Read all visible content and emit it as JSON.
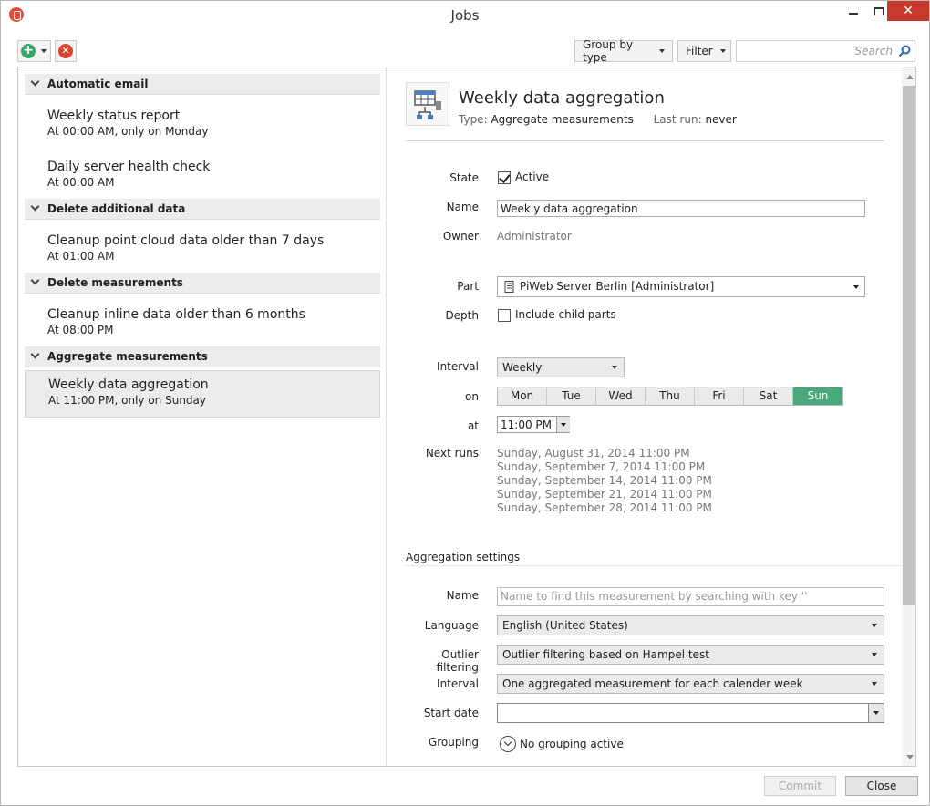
{
  "window": {
    "title": "Jobs"
  },
  "toolbar": {
    "group_by_label": "Group by type",
    "filter_label": "Filter",
    "search_placeholder": "Search"
  },
  "job_groups": [
    {
      "label": "Automatic email",
      "jobs": [
        {
          "name": "Weekly status report",
          "schedule": "At 00:00 AM, only on Monday"
        },
        {
          "name": "Daily server health check",
          "schedule": "At 00:00 AM"
        }
      ]
    },
    {
      "label": "Delete additional data",
      "jobs": [
        {
          "name": "Cleanup point cloud data older than 7 days",
          "schedule": "At 01:00 AM"
        }
      ]
    },
    {
      "label": "Delete measurements",
      "jobs": [
        {
          "name": "Cleanup inline data older than 6 months",
          "schedule": "At 08:00 PM"
        }
      ]
    },
    {
      "label": "Aggregate measurements",
      "jobs": [
        {
          "name": "Weekly data aggregation",
          "schedule": "At 11:00 PM, only on Sunday"
        }
      ]
    }
  ],
  "detail": {
    "title": "Weekly data aggregation",
    "type_label": "Type:",
    "type_value": "Aggregate measurements",
    "last_run_label": "Last run:",
    "last_run_value": "never",
    "state_label": "State",
    "active_label": "Active",
    "name_label": "Name",
    "name_value": "Weekly data aggregation",
    "owner_label": "Owner",
    "owner_value": "Administrator",
    "part_label": "Part",
    "part_value": "PiWeb Server Berlin [Administrator]",
    "depth_label": "Depth",
    "include_child_label": "Include child parts",
    "interval_label": "Interval",
    "interval_value": "Weekly",
    "on_label": "on",
    "days": [
      "Mon",
      "Tue",
      "Wed",
      "Thu",
      "Fri",
      "Sat",
      "Sun"
    ],
    "at_label": "at",
    "time_value": "11:00 PM",
    "next_runs_label": "Next runs",
    "next_runs": [
      "Sunday, August 31, 2014 11:00 PM",
      "Sunday, September 7, 2014 11:00 PM",
      "Sunday, September 14, 2014 11:00 PM",
      "Sunday, September 21, 2014 11:00 PM",
      "Sunday, September 28, 2014 11:00 PM"
    ]
  },
  "aggregation": {
    "section_title": "Aggregation settings",
    "name_label": "Name",
    "name_placeholder": "Name to find this measurement by searching with key ''",
    "language_label": "Language",
    "language_value": "English (United States)",
    "outlier_label": "Outlier filtering",
    "outlier_value": "Outlier filtering based on Hampel test",
    "interval_label": "Interval",
    "interval_value": "One aggregated measurement for each calender week",
    "start_date_label": "Start date",
    "start_date_value": "",
    "grouping_label": "Grouping",
    "grouping_value": "No grouping active"
  },
  "footer": {
    "commit_label": "Commit",
    "close_label": "Close"
  },
  "colors": {
    "accent_green": "#4aa77c",
    "close_red": "#c7392b",
    "delete_red": "#d9452f"
  }
}
